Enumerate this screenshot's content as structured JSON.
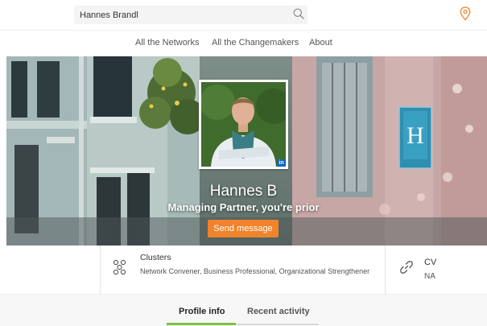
{
  "search": {
    "value": "Hannes Brandl",
    "placeholder": "Search"
  },
  "nav": {
    "items": [
      {
        "label": "All the Networks"
      },
      {
        "label": "All the Changemakers"
      },
      {
        "label": "About"
      }
    ]
  },
  "profile": {
    "name": "Hannes B",
    "role": "Managing Partner, you're prior",
    "linkedin_badge": "in",
    "send_message_label": "Send message"
  },
  "info": {
    "clusters": {
      "title": "Clusters",
      "value": "Network Convener, Business Professional, Organizational Strengthener",
      "icon": "clusters-icon"
    },
    "cv": {
      "title": "CV",
      "value": "NA",
      "icon": "link-icon"
    }
  },
  "tabs": [
    {
      "label": "Profile info",
      "active": true
    },
    {
      "label": "Recent activity",
      "active": false
    }
  ],
  "colors": {
    "accent": "#f0832b",
    "tab_active": "#7bc242",
    "linkedin": "#0b66c2"
  }
}
